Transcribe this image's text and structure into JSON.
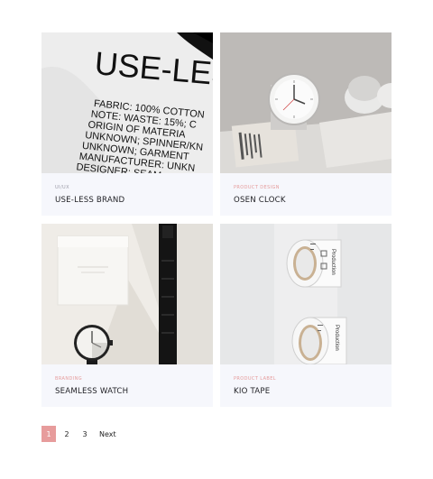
{
  "cards": [
    {
      "category": "UI/UX",
      "title": "USE-LESS BRAND",
      "image_text": "USE-LES",
      "image_lines": [
        "FABRIC: 100% COTTON",
        "NOTE: WASTE: 15%; C",
        "ORIGIN OF MATERIA",
        "UNKNOWN; SPINNER/KN",
        "UNKNOWN; GARMENT",
        "MANUFACTURER: UNKN",
        "DESIGNER: SEAM"
      ]
    },
    {
      "category": "PRODUCT DESIGN",
      "title": "OSEN CLOCK"
    },
    {
      "category": "BRANDING",
      "title": "SEAMLESS WATCH"
    },
    {
      "category": "PRODUCT LABEL",
      "title": "KIO TAPE",
      "tape_text": "Production"
    }
  ],
  "pagination": {
    "pages": [
      "1",
      "2",
      "3"
    ],
    "current": "1",
    "next_label": "Next"
  },
  "colors": {
    "accent": "#e79c9c",
    "card_bg": "#f6f7fc"
  }
}
